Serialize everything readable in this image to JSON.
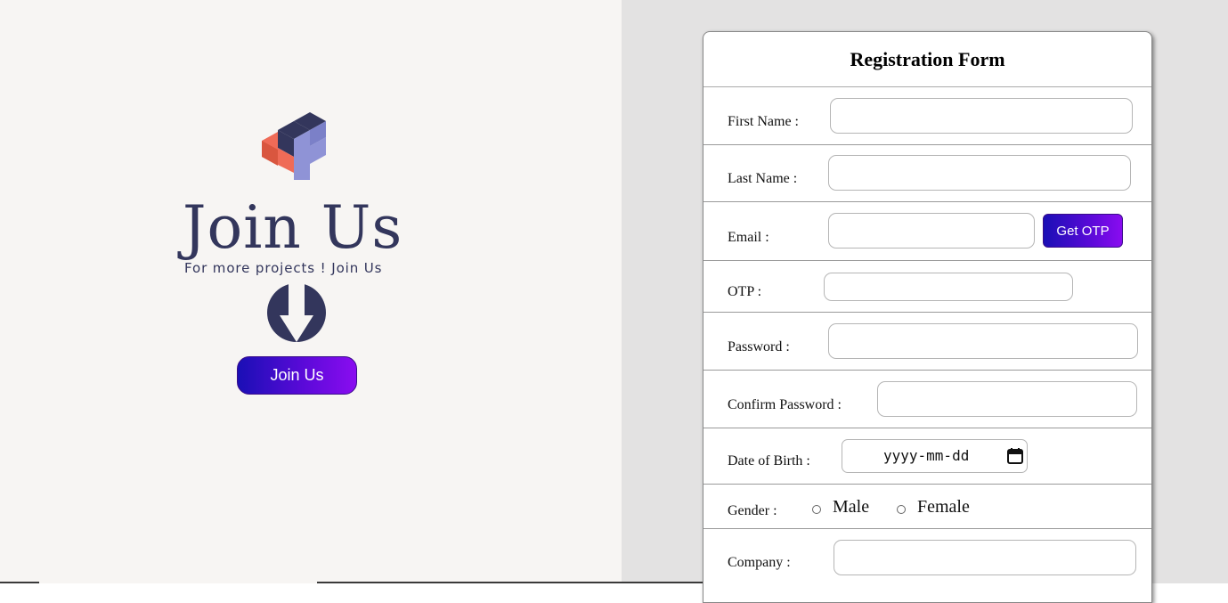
{
  "hero": {
    "title": "Join Us",
    "subtitle": "For more projects ! Join Us",
    "button_label": "Join Us"
  },
  "form": {
    "title": "Registration Form",
    "first_name_label": "First Name :",
    "last_name_label": "Last Name :",
    "email_label": "Email :",
    "get_otp_label": "Get OTP",
    "otp_label": "OTP :",
    "password_label": "Password :",
    "confirm_password_label": "Confirm Password :",
    "dob_label": "Date of Birth :",
    "dob_placeholder": "yyyy-mm-dd",
    "gender_label": "Gender :",
    "gender_options": [
      "Male",
      "Female"
    ],
    "company_label": "Company :"
  },
  "colors": {
    "brand_navy": "#33365c",
    "logo_orange": "#ef6b57",
    "logo_lavender": "#8f93d6",
    "button_gradient_start": "#1a0fb5",
    "button_gradient_end": "#8a0cf0"
  },
  "icons": [
    "logo-cube-icon",
    "down-arrow-icon",
    "calendar-icon"
  ]
}
